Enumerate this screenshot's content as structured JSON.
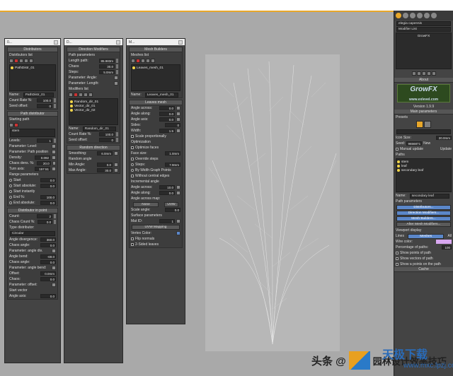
{
  "viewport": {
    "bg": "#a9a9a9"
  },
  "distributors_panel": {
    "title": "0...",
    "header": "Distributors",
    "list_label": "Distributors list",
    "items": [
      "PathDistr_01"
    ],
    "name_label": "Name:",
    "name_value": "PathDistr_01",
    "count_rate_label": "Count Rate %:",
    "count_rate": "100.0",
    "seed_offset_label": "Seed offset:",
    "seed_offset": "0",
    "path_distributor": {
      "header": "Path distributor",
      "starting_path": "Starting path",
      "path_field": "stem",
      "levels_label": "Levels:",
      "levels": "1",
      "param_level": "Parameter: Level:",
      "param_path_position": "Parameter: Path position",
      "density_label": "Density:",
      "density": "0.092",
      "chaos_dens_label": "Chaos dens. %:",
      "chaos_dens": "20.0",
      "turn_axis_label": "Turn axis:",
      "turn_axis": "157.51",
      "range_params": "Range parameters",
      "start_label": "Start",
      "start_value": "0.0",
      "start_absolute": "Start absolute:",
      "start_abs_value": "0.0",
      "start_instantly": "Start instantly",
      "end_label": "End %:",
      "end_value": "100.0",
      "end_absolute": "End absolute:",
      "end_abs_value": "0.0"
    },
    "distributor_in_point": {
      "header": "Distributor in point",
      "count_label": "Count:",
      "count": "2",
      "chaos_count_label": "Chaos Count %:",
      "chaos_count": "0.0",
      "type_label": "Type distributor:",
      "type_value": "Circular",
      "angle_div_label": "Angle divergence:",
      "angle_div": "360.0",
      "chaos_angle_label": "Chaos angle:",
      "chaos_angle": "0.0",
      "param_angle_div": "Parameter: angle div.",
      "angle_bend_label": "Angle bend:",
      "angle_bend": "-69.0",
      "chaos_angle2_label": "Chaos angle:",
      "chaos_angle2": "0.0",
      "param_angle_bend": "Parameter: angle bend:",
      "offset_label": "Offset:",
      "offset": "0.0mm",
      "chaos_label": "Chaos:",
      "chaos": "0.0",
      "param_offset": "Parameter: offset:",
      "start_vector": "Start vector",
      "angle_axis_label": "Angle axis:",
      "angle_axis": "0.0"
    }
  },
  "direction_panel": {
    "title": "D...",
    "header": "Direction Modifiers",
    "path_params": "Path parameters",
    "length_path_label": "Length path:",
    "length_path": "85.983m",
    "chaos_label": "Chaos",
    "chaos": "30.0",
    "steps_label": "Steps:",
    "steps": "5.0mm",
    "param_angle": "Parameter: Angle:",
    "param_length": "Parameter: Length:",
    "modifiers_list": "Modifiers list",
    "items": [
      "Random_dir_01",
      "Vector_dir_01",
      "Vector_dir_02"
    ],
    "name_label": "Name:",
    "name_value": "Random_dir_01",
    "count_rate_label": "Count Rate %:",
    "count_rate": "100.0",
    "seed_offset_label": "Seed offset:",
    "seed_offset": "0",
    "random_direction": {
      "header": "Random direction",
      "smoothing_label": "Smoothing:",
      "smoothing": "6.0mm",
      "random_angle": "Random angle",
      "min_angle_label": "Min Angle:",
      "min_angle": "0.0",
      "max_angle_label": "Max Angle:",
      "max_angle": "30.0"
    }
  },
  "mesh_panel": {
    "title": "M...",
    "header": "Mesh Builders",
    "meshes_list": "Meshes list",
    "items": [
      "Leaves_mesh_01"
    ],
    "name_label": "Name:",
    "name_value": "Leaves_mesh_01",
    "leaves_mesh": {
      "header": "Leaves mesh",
      "angle_across_label": "Angle across:",
      "angle_across": "0.0",
      "angle_along_label": "Angle along:",
      "angle_along": "0.0",
      "angle_axis_label": "Angle axis:",
      "angle_axis": "0.0",
      "sides_label": "Sides:",
      "sides": "0",
      "width_label": "Width:",
      "width": "1.5",
      "scale_prop": "Scale proportionally",
      "optimization": "Optimization",
      "optimize_faces": "Optimize faces",
      "face_size_label": "Face size:",
      "face_size": "1.0mm",
      "override_steps": "Override steps",
      "steps_label": "Steps:",
      "steps": "7.9mm",
      "by_width_graph": "By Width Graph Points",
      "without_central": "Without central edges",
      "incremental_angle": "Incremental angle",
      "inc_across_label": "Angle across:",
      "inc_across": "10.0",
      "inc_along_label": "Angle along:",
      "inc_along": "0.0",
      "angle_across_map": "Angle across map:",
      "none_btn": "None",
      "uvw_btn": "UVW",
      "scale_angle_label": "Scale angle:",
      "scale_angle": "0.0",
      "surface_params": "Surface parameters",
      "mat_id_label": "Mat ID:",
      "mat_id": "1",
      "uvw_mapping": "UVW Mapping",
      "vertex_color": "Vertex Color:",
      "flip_normals": "Flip normals",
      "two_sided": "2-Sided leaves"
    }
  },
  "command_panel": {
    "object_name": "elegia capensis",
    "modifier_list": "Modifier List",
    "stack_item": "GrowFX",
    "about": "About",
    "logo": "GrowFX",
    "site": "www.exlevel.com",
    "version": "Version 1.9.9",
    "main_params": "Main parameters",
    "presets": "Presets",
    "icon_size_label": "Icon Size:",
    "icon_size": "20.0mm",
    "seed_label": "Seed:",
    "seed": "9656871",
    "new_btn": "New",
    "manual_update": "Manual update",
    "update_btn": "Update",
    "paths": "Paths",
    "path_items": [
      "stem",
      "leaf",
      "secondary leaf"
    ],
    "name_label": "Name:",
    "name_value": "secondary leaf",
    "path_parameters": "Path parameters",
    "btn_distributors": "Distributors...",
    "btn_direction": "Direction Modifiers...",
    "btn_mesh": "Mesh Builders...",
    "btn_after": "After Mesh Modifiers...",
    "viewport_display": "Viewport display",
    "lines": "Lines",
    "meshes": "Meshes",
    "all": "All",
    "wire_color": "Wire color:",
    "percentage": "Percentage of paths:",
    "percentage_val": "100",
    "show_points": "Show points of path",
    "show_vectors": "Show vectors of path",
    "show_points_on": "Show a points on the path",
    "cache": "Cache",
    "accent": "#5b87c9"
  },
  "watermark": {
    "a": "头条 @",
    "b": "园林设计效率技巧",
    "c": "天极下载",
    "d": "www.mxc.lpzj.com"
  }
}
